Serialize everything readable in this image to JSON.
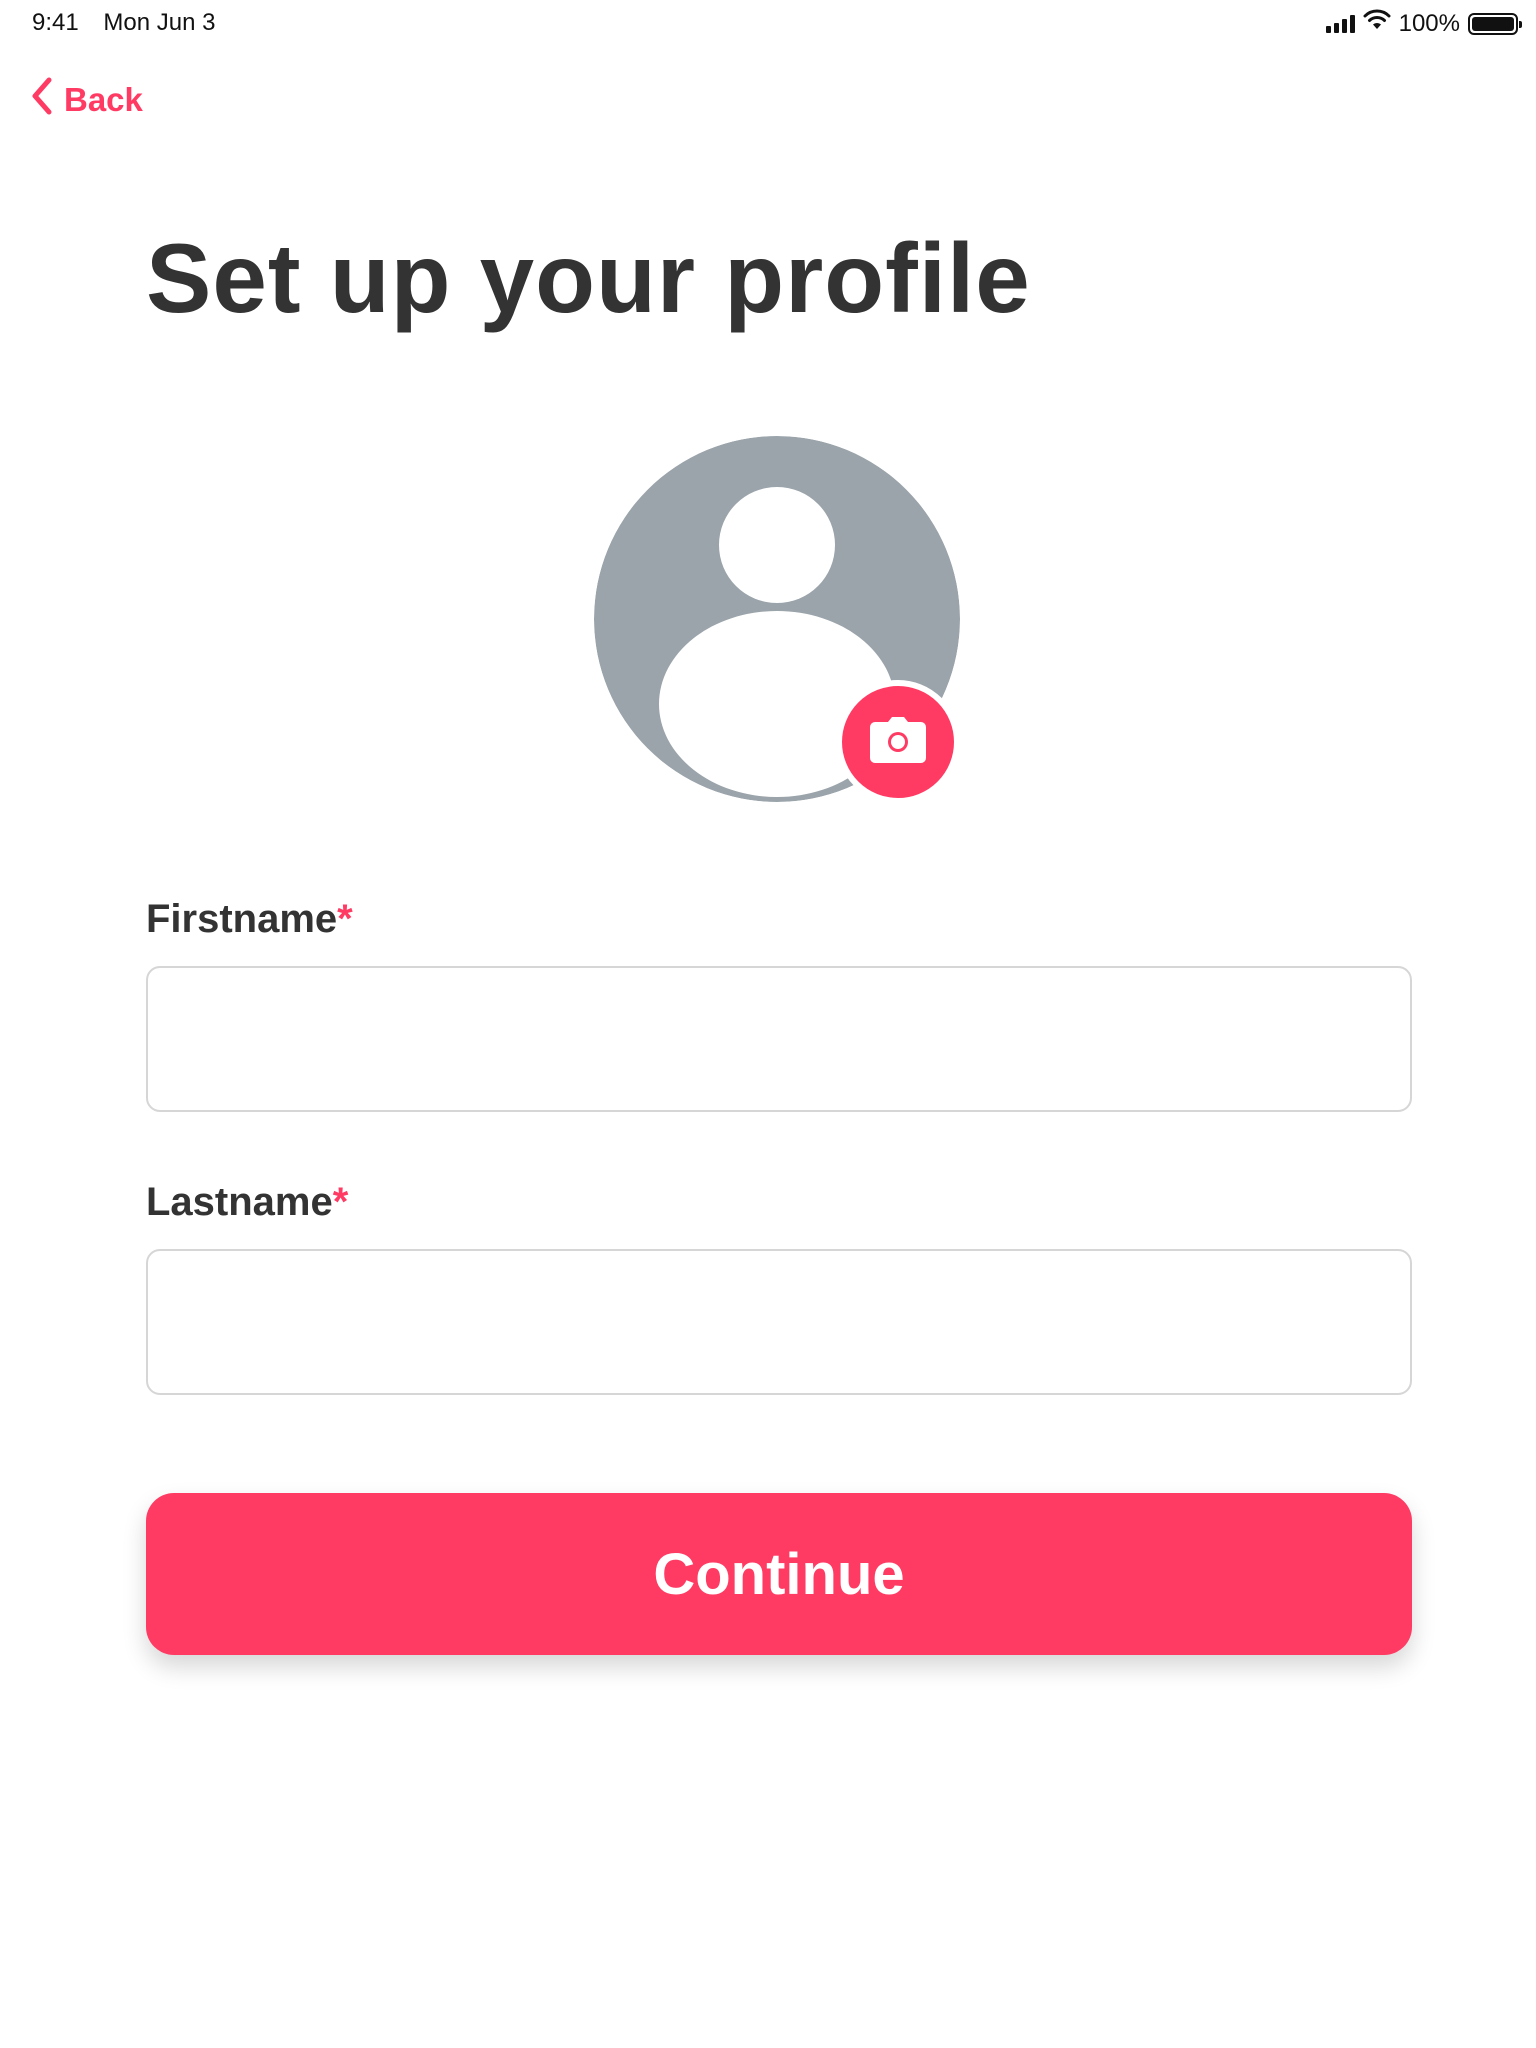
{
  "status_bar": {
    "time": "9:41",
    "date": "Mon Jun 3",
    "battery_percent": "100%"
  },
  "nav": {
    "back_label": "Back"
  },
  "page": {
    "title": "Set up your profile"
  },
  "avatar": {
    "placeholder_icon": "user-silhouette-icon",
    "camera_icon": "camera-icon"
  },
  "form": {
    "firstname": {
      "label": "Firstname",
      "required_mark": "*",
      "value": "",
      "placeholder": ""
    },
    "lastname": {
      "label": "Lastname",
      "required_mark": "*",
      "value": "",
      "placeholder": ""
    },
    "continue_label": "Continue"
  },
  "colors": {
    "accent": "#ff3b64",
    "title_text": "#333333",
    "avatar_gray": "#9aa4aa",
    "input_border": "#d6d6d6"
  }
}
